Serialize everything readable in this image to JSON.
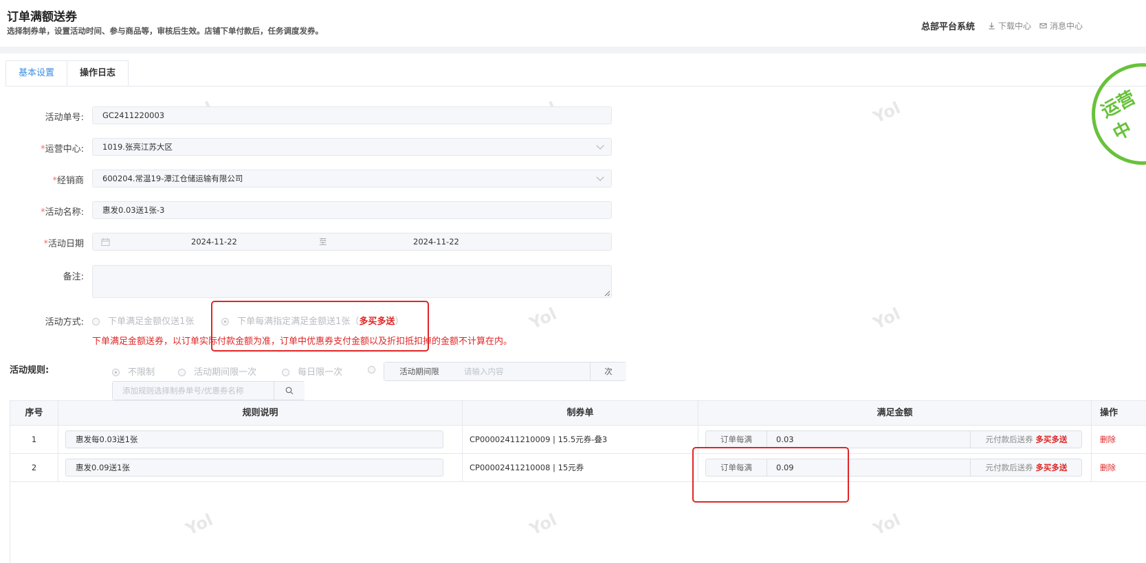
{
  "header": {
    "title": "订单满额送券",
    "subtitle": "选择制券单，设置活动时间、参与商品等，审核后生效。店铺下单付款后，任务调度发券。",
    "system_name": "总部平台系统",
    "download_center": "下载中心",
    "message_center": "消息中心"
  },
  "tabs": [
    {
      "label": "基本设置",
      "active": true
    },
    {
      "label": "操作日志",
      "active": false
    }
  ],
  "stamp": {
    "text": "运营中"
  },
  "watermark": "Yol",
  "form": {
    "activity_no": {
      "label": "活动单号:",
      "value": "GC2411220003"
    },
    "ops_center": {
      "label": "运营中心:",
      "required": true,
      "value": "1019.张亮江苏大区"
    },
    "dealer": {
      "label": "经销商",
      "required": true,
      "value": "600204.常温19-潭江仓储运输有限公司"
    },
    "activity_name": {
      "label": "活动名称:",
      "required": true,
      "value": "惠发0.03送1张-3"
    },
    "activity_date": {
      "label": "活动日期",
      "required": true,
      "start": "2024-11-22",
      "separator": "至",
      "end": "2024-11-22"
    },
    "remark": {
      "label": "备注:",
      "value": ""
    },
    "method": {
      "label": "活动方式:",
      "option1": "下单满足金额仅送1张",
      "option2_prefix": "下单每满指定满足金额送1张（",
      "option2_highlight": "多买多送",
      "option2_suffix": "）",
      "selected": 2,
      "note": "下单满足金额送券，以订单实际付款金额为准，订单中优惠券支付金额以及折扣抵扣掉的金额不计算在内。"
    }
  },
  "rules": {
    "label": "活动规则:",
    "options": [
      "不限制",
      "活动期间限一次",
      "每日限一次"
    ],
    "selected": 0,
    "period_limit_label": "活动期间限",
    "period_limit_placeholder": "请输入内容",
    "period_limit_unit": "次",
    "search_placeholder": "添加规则选择制券单号/优惠券名称"
  },
  "table": {
    "headers": [
      "序号",
      "规则说明",
      "制券单",
      "满足金额",
      "操作"
    ],
    "rows": [
      {
        "no": "1",
        "desc": "惠发每0.03送1张",
        "coupon": "CP00002411210009 | 15.5元券-叠3",
        "prefix": "订单每满",
        "amount": "0.03",
        "suffix": "元付款后送券",
        "tag": "多买多送",
        "action": "删除"
      },
      {
        "no": "2",
        "desc": "惠发0.09送1张",
        "coupon": "CP00002411210008 | 15元券",
        "prefix": "订单每满",
        "amount": "0.09",
        "suffix": "元付款后送券",
        "tag": "多买多送",
        "action": "删除"
      }
    ]
  },
  "colors": {
    "primary": "#3a8ee6",
    "danger": "#e02424",
    "stamp": "#67c23a"
  }
}
